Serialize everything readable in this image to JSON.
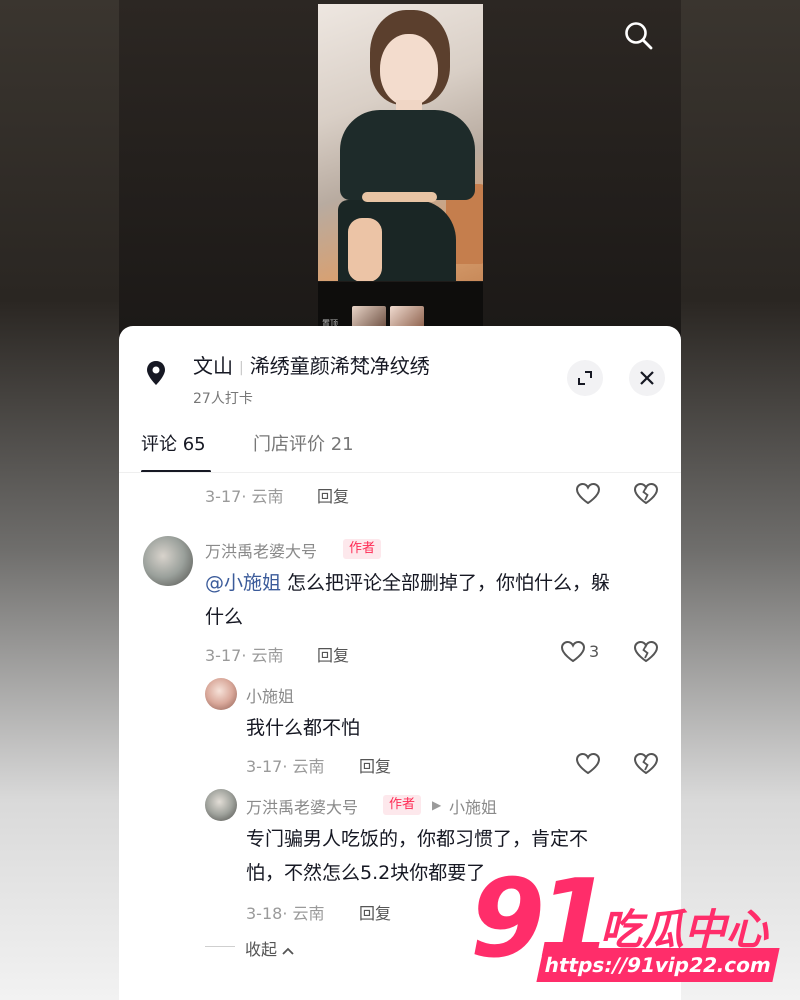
{
  "location": {
    "city": "文山",
    "shop": "浠绣童颜浠梵净纹绣",
    "checkins": "27人打卡"
  },
  "tabs": {
    "comments": "评论 65",
    "reviews": "门店评价 21"
  },
  "thumb_label": "置顶",
  "comments": [
    {
      "meta": "3-17· 云南",
      "reply": "回复"
    },
    {
      "user": "万洪禹老婆大号",
      "badge": "作者",
      "mention": "@小施姐",
      "text_line1": " 怎么把评论全部删掉了，你怕什么，躲",
      "text_line2": "什么",
      "meta": "3-17· 云南",
      "reply": "回复",
      "likes": "3"
    },
    {
      "user": "小施姐",
      "text": "我什么都不怕",
      "meta": "3-17· 云南",
      "reply": "回复"
    },
    {
      "user": "万洪禹老婆大号",
      "badge": "作者",
      "reply_to": "小施姐",
      "text_line1": "专门骗男人吃饭的，你都习惯了，肯定不",
      "text_line2": "怕，不然怎么5.2块你都要了",
      "meta": "3-18· 云南",
      "reply": "回复"
    }
  ],
  "collapse_label": "收起",
  "watermark": {
    "number": "91",
    "name": "吃瓜中心",
    "url": "https://91vip22.com"
  },
  "colors": {
    "accent": "#fe2c55",
    "watermark": "#ff2d6a",
    "mention": "#3b5b9a"
  }
}
